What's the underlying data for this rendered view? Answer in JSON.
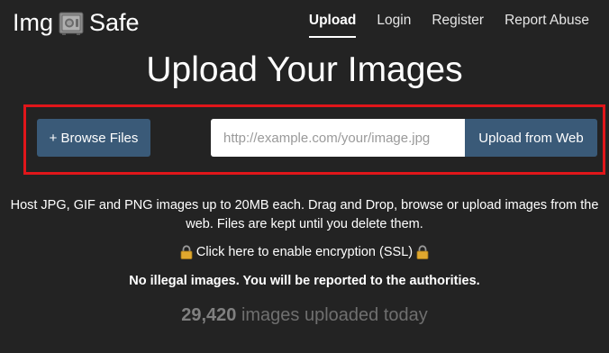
{
  "logo": {
    "left_text": "Img",
    "right_text": "Safe",
    "icon": "safe-icon"
  },
  "nav": {
    "items": [
      {
        "label": "Upload",
        "active": true
      },
      {
        "label": "Login",
        "active": false
      },
      {
        "label": "Register",
        "active": false
      },
      {
        "label": "Report Abuse",
        "active": false
      }
    ]
  },
  "hero": {
    "title": "Upload Your Images"
  },
  "upload": {
    "browse_label": "+ Browse Files",
    "url_placeholder": "http://example.com/your/image.jpg",
    "url_value": "",
    "web_button_label": "Upload from Web"
  },
  "info": {
    "description": "Host JPG, GIF and PNG images up to 20MB each. Drag and Drop, browse or upload images from the web. Files are kept until you delete them.",
    "ssl_link": "Click here to enable encryption (SSL)",
    "warning": "No illegal images. You will be reported to the authorities.",
    "count_number": "29,420",
    "count_text": "images uploaded today"
  },
  "colors": {
    "background": "#232323",
    "button": "#3a5a78",
    "highlight_border": "#e0161a",
    "lock": "#e0a82e"
  }
}
